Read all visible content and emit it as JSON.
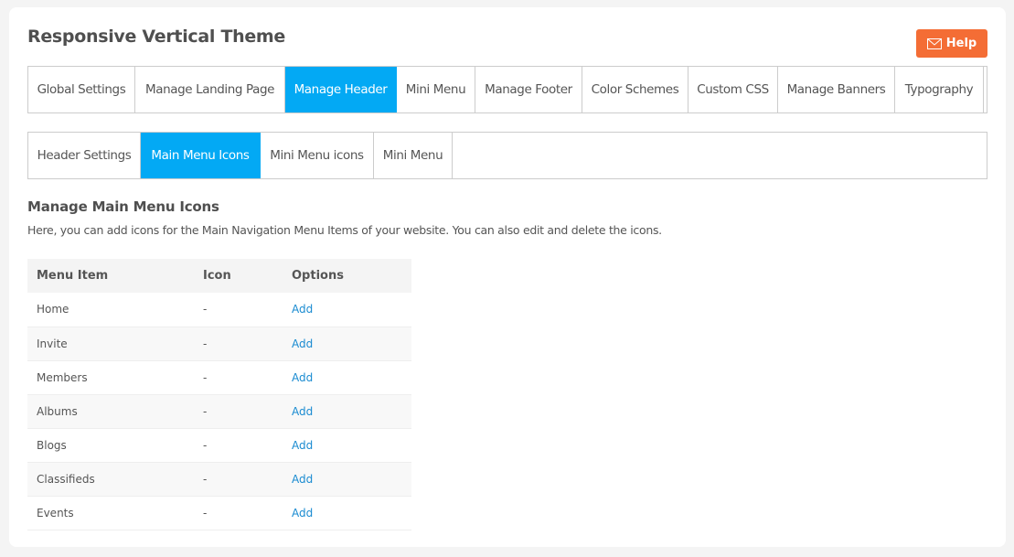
{
  "title": "Responsive Vertical Theme",
  "help": {
    "label": "Help",
    "icon": "envelope-icon",
    "color": "#f46d35"
  },
  "accent": "#03a9f4",
  "main_tabs": [
    {
      "label": "Global Settings"
    },
    {
      "label": "Manage Landing Page"
    },
    {
      "label": "Manage Header",
      "active": true
    },
    {
      "label": "Mini Menu"
    },
    {
      "label": "Manage Footer"
    },
    {
      "label": "Color Schemes"
    },
    {
      "label": "Custom CSS"
    },
    {
      "label": "Manage Banners"
    },
    {
      "label": "Typography"
    }
  ],
  "sub_tabs": [
    {
      "label": "Header Settings"
    },
    {
      "label": "Main Menu Icons",
      "active": true
    },
    {
      "label": "Mini Menu icons"
    },
    {
      "label": "Mini Menu"
    }
  ],
  "section": {
    "heading": "Manage Main Menu Icons",
    "description": "Here, you can add icons for the Main Navigation Menu Items of your website. You can also edit and delete the icons."
  },
  "table": {
    "headers": [
      "Menu Item",
      "Icon",
      "Options"
    ],
    "rows": [
      {
        "item": "Home",
        "icon": "-",
        "option": "Add"
      },
      {
        "item": "Invite",
        "icon": "-",
        "option": "Add"
      },
      {
        "item": "Members",
        "icon": "-",
        "option": "Add"
      },
      {
        "item": "Albums",
        "icon": "-",
        "option": "Add"
      },
      {
        "item": "Blogs",
        "icon": "-",
        "option": "Add"
      },
      {
        "item": "Classifieds",
        "icon": "-",
        "option": "Add"
      },
      {
        "item": "Events",
        "icon": "-",
        "option": "Add"
      }
    ]
  }
}
